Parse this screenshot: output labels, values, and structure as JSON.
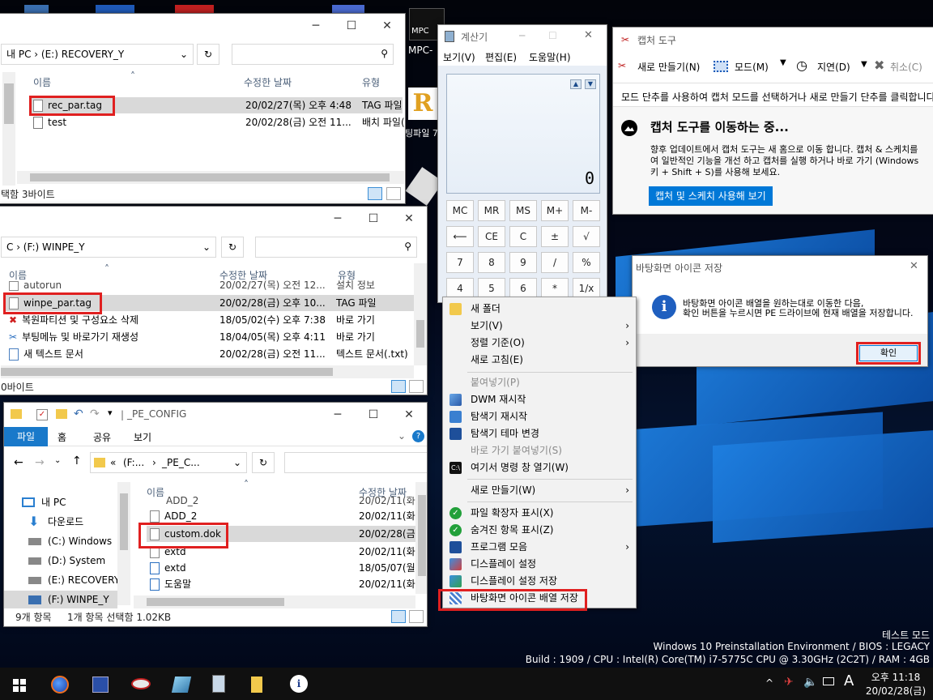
{
  "explorer1": {
    "address": "내 PC  ›  (E:) RECOVERY_Y",
    "col_name": "이름",
    "col_date": "수정한 날짜",
    "col_type": "유형",
    "rows": [
      {
        "name": "rec_par.tag",
        "date": "20/02/27(목) 오후 4:48",
        "type": "TAG 파일"
      },
      {
        "name": "test",
        "date": "20/02/28(금) 오전 11...",
        "type": "배치 파일("
      }
    ],
    "status": "택함 3바이트"
  },
  "explorer2": {
    "address": "C  ›  (F:) WINPE_Y",
    "col_name": "이름",
    "col_date": "수정한 날짜",
    "col_type": "유형",
    "rows": [
      {
        "name": "autorun",
        "date": "20/02/27(목) 오전 12...",
        "type": "설치 정보"
      },
      {
        "name": "winpe_par.tag",
        "date": "20/02/28(금) 오후 10...",
        "type": "TAG 파일"
      },
      {
        "name": "복원파티션 및 구성요소 삭제",
        "date": "18/05/02(수) 오후 7:38",
        "type": "바로 가기"
      },
      {
        "name": "부팅메뉴 및 바로가기 재생성",
        "date": "18/04/05(목) 오후 4:11",
        "type": "바로 가기"
      },
      {
        "name": "새 텍스트 문서",
        "date": "20/02/28(금) 오전 11...",
        "type": "텍스트 문서(.txt)"
      }
    ],
    "status": "0바이트"
  },
  "explorer3": {
    "title": "_PE_CONFIG",
    "tabs": [
      "파일",
      "홈",
      "공유",
      "보기"
    ],
    "address_parts": [
      "«",
      "(F:...",
      "›",
      "_PE_C..."
    ],
    "tree": [
      "내 PC",
      "다운로드",
      "(C:) Windows",
      "(D:) System",
      "(E:) RECOVERY_",
      "(F:) WINPE_Y"
    ],
    "col_name": "이름",
    "col_date": "수정한 날짜",
    "rows": [
      {
        "name": "ADD_2",
        "date": "20/02/11(화"
      },
      {
        "name": "ADD_2",
        "date": "20/02/11(화"
      },
      {
        "name": "custom.dok",
        "date": "20/02/28(금"
      },
      {
        "name": "extd",
        "date": "20/02/11(화"
      },
      {
        "name": "extd",
        "date": "18/05/07(월"
      },
      {
        "name": "도움말",
        "date": "20/02/11(화"
      }
    ],
    "status_count": "9개 항목",
    "status_selected": "1개 항목 선택함 1.02KB"
  },
  "calculator": {
    "title": "계산기",
    "menu": [
      "보기(V)",
      "편집(E)",
      "도움말(H)"
    ],
    "display": "0",
    "buttons": [
      [
        "MC",
        "MR",
        "MS",
        "M+",
        "M-"
      ],
      [
        "⟵",
        "CE",
        "C",
        "±",
        "√"
      ],
      [
        "7",
        "8",
        "9",
        "/",
        "%"
      ],
      [
        "4",
        "5",
        "6",
        "*",
        "1/x"
      ]
    ]
  },
  "snipping": {
    "title": "캡처 도구",
    "toolbar": {
      "new": "새로 만들기(N)",
      "mode": "모드(M)",
      "delay": "지연(D)",
      "cancel": "취소(C)"
    },
    "hint": "모드 단추를 사용하여 캡처 모드를 선택하거나 새로 만들기 단추를 클릭합니다.",
    "moving_title": "캡처 도구를 이동하는 중...",
    "moving_body_1": "향후 업데이트에서 캡처 도구는 새 홈으로 이동 합니다. 캡처 & 스케치를",
    "moving_body_2": "여 일반적인 기능을 개선 하고 캡처를 실행 하거나 바로 가기 (Windows",
    "moving_body_3": "키 + Shift + S)를 사용해 보세요.",
    "try_button": "캡처 및 스케치 사용해 보기"
  },
  "dialog": {
    "title": "바탕화면 아이콘 저장",
    "message_1": "바탕화면 아이콘 배열을 원하는대로 이동한 다음,",
    "message_2": "확인 버튼을 누르시면 PE 드라이브에 현재 배열을 저장합니다.",
    "ok": "확인"
  },
  "context_menu": {
    "items": [
      {
        "label": "새 폴더",
        "icon": "folder-icon"
      },
      {
        "label": "보기(V)",
        "submenu": true
      },
      {
        "label": "정렬 기준(O)",
        "submenu": true
      },
      {
        "label": "새로 고침(E)"
      },
      {
        "label": "붙여넣기(P)",
        "disabled": true
      },
      {
        "label": "DWM 재시작",
        "icon": "dwm-icon"
      },
      {
        "label": "탐색기 재시작",
        "icon": "explorer-restart-icon"
      },
      {
        "label": "탐색기 테마 변경",
        "icon": "theme-icon"
      },
      {
        "label": "바로 가기 붙여넣기(S)",
        "disabled": true
      },
      {
        "label": "여기서 명령 창 열기(W)",
        "icon": "cmd-icon"
      },
      {
        "label": "새로 만들기(W)",
        "submenu": true
      },
      {
        "label": "파일 확장자 표시(X)",
        "icon": "check-icon"
      },
      {
        "label": "숨겨진 항목 표시(Z)",
        "icon": "check-icon"
      },
      {
        "label": "프로그램 모음",
        "icon": "programs-icon",
        "submenu": true
      },
      {
        "label": "디스플레이 설정",
        "icon": "display-icon"
      },
      {
        "label": "디스플레이 설정 저장",
        "icon": "display-save-icon"
      },
      {
        "label": "바탕화면 아이콘 배열 저장",
        "icon": "desktop-save-icon"
      }
    ]
  },
  "desktop_icons": {
    "mpc": "MPC-",
    "partial": "팅파일 7"
  },
  "watermark": {
    "mode": "테스트 모드",
    "line1": "Windows 10 Preinstallation Environment / BIOS : LEGACY",
    "line2": "Build : 1909 / CPU : Intel(R) Core(TM) i7-5775C CPU @ 3.30GHz (2C2T) / RAM : 4GB"
  },
  "taskbar": {
    "clock_time": "오후 11:18",
    "clock_date": "20/02/28(금)",
    "ime": "A",
    "tray_icons": [
      "chevron-up-icon",
      "network-icon",
      "volume-icon",
      "keyboard-icon"
    ],
    "pinned": [
      "start-icon",
      "firefox-icon",
      "save-icon",
      "snipping-icon",
      "notepad-icon",
      "calculator-icon",
      "folder-icon",
      "info-icon"
    ]
  },
  "colors": {
    "accent": "#0078d7",
    "highlight_red": "#e02020",
    "desktop_blue": "#1e7fe0",
    "taskbar": "#101010"
  }
}
